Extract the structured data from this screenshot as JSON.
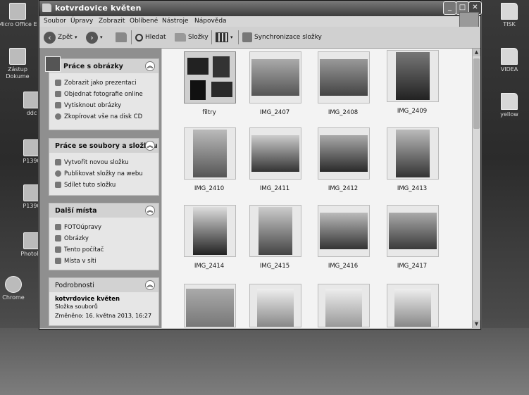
{
  "window": {
    "title": "kotvrdovice květen"
  },
  "menu": [
    "Soubor",
    "Úpravy",
    "Zobrazit",
    "Oblíbené",
    "Nástroje",
    "Nápověda"
  ],
  "toolbar": {
    "back": "Zpět",
    "search": "Hledat",
    "folders": "Složky",
    "sync": "Synchronizace složky"
  },
  "panels": {
    "pictures": {
      "title": "Práce s obrázky",
      "items": [
        "Zobrazit jako prezentaci",
        "Objednat fotografie online",
        "Vytisknout obrázky",
        "Zkopírovat vše na disk CD"
      ]
    },
    "files": {
      "title": "Práce se soubory a složkou",
      "items": [
        "Vytvořit novou složku",
        "Publikovat složky na webu",
        "Sdílet tuto složku"
      ]
    },
    "places": {
      "title": "Další místa",
      "items": [
        "FOTOúpravy",
        "Obrázky",
        "Tento počítač",
        "Místa v síti"
      ]
    },
    "details": {
      "title": "Podrobnosti",
      "name": "kotvrdovice květen",
      "type": "Složka souborů",
      "modified": "Změněno: 16. května 2013, 16:27"
    }
  },
  "thumbnails": [
    "filtry",
    "IMG_2407",
    "IMG_2408",
    "IMG_2409",
    "IMG_2410",
    "IMG_2411",
    "IMG_2412",
    "IMG_2413",
    "IMG_2414",
    "IMG_2415",
    "IMG_2416",
    "IMG_2417"
  ],
  "desktop": {
    "left": [
      "Micro Office E",
      "Zástup Dokume",
      "ddc",
      "P1390",
      "P1390",
      "PhotoFil",
      "Chrome"
    ],
    "right": [
      "TISK",
      "VIDEA",
      "yellow"
    ]
  }
}
